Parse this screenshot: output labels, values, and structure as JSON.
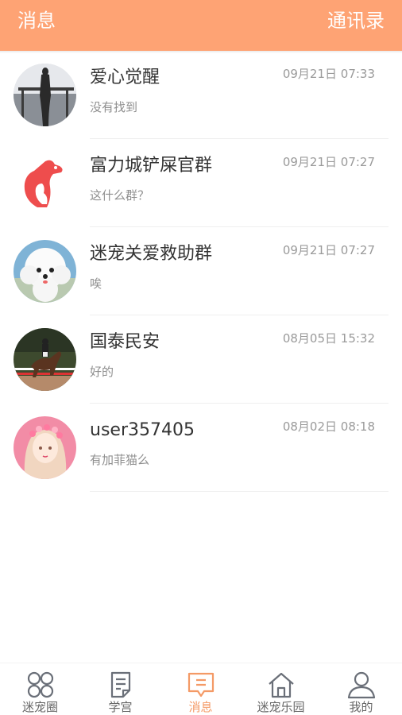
{
  "header": {
    "title": "消息",
    "contacts": "通讯录"
  },
  "conversations": [
    {
      "name": "爱心觉醒",
      "time": "09月21日 07:33",
      "message": "没有找到"
    },
    {
      "name": "富力城铲屎官群",
      "time": "09月21日 07:27",
      "message": "这什么群？"
    },
    {
      "name": "迷宠关爱救助群",
      "time": "09月21日 07:27",
      "message": "唉"
    },
    {
      "name": "国泰民安",
      "time": "08月05日 15:32",
      "message": "好的"
    },
    {
      "name": "user357405",
      "time": "08月02日 08:18",
      "message": "有加菲猫么"
    }
  ],
  "tabs": [
    {
      "label": "迷宠圈",
      "icon": "grid-circles-icon"
    },
    {
      "label": "学宫",
      "icon": "document-icon"
    },
    {
      "label": "消息",
      "icon": "message-icon",
      "active": true
    },
    {
      "label": "迷宠乐园",
      "icon": "home-icon"
    },
    {
      "label": "我的",
      "icon": "user-icon"
    }
  ],
  "colors": {
    "accent": "#fea374",
    "active_tab": "#f49a66",
    "inactive_tab": "#666666"
  }
}
